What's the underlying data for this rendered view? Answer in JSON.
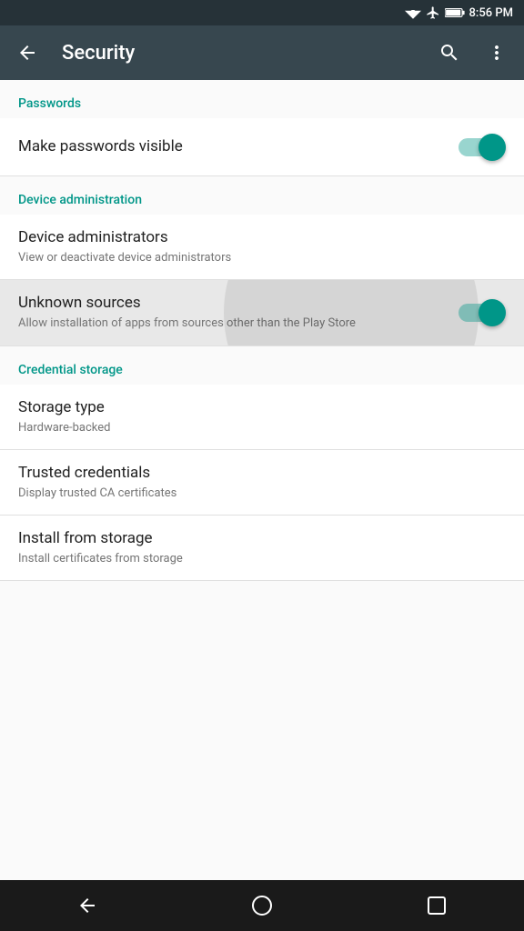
{
  "statusBar": {
    "time": "8:56 PM"
  },
  "appBar": {
    "title": "Security",
    "backLabel": "←",
    "searchLabel": "🔍",
    "moreLabel": "⋮"
  },
  "sections": [
    {
      "id": "passwords",
      "header": "Passwords",
      "items": [
        {
          "id": "make-passwords-visible",
          "title": "Make passwords visible",
          "subtitle": "",
          "hasToggle": true,
          "toggleOn": true,
          "highlighted": false
        }
      ]
    },
    {
      "id": "device-administration",
      "header": "Device administration",
      "items": [
        {
          "id": "device-administrators",
          "title": "Device administrators",
          "subtitle": "View or deactivate device administrators",
          "hasToggle": false,
          "highlighted": false
        },
        {
          "id": "unknown-sources",
          "title": "Unknown sources",
          "subtitle": "Allow installation of apps from sources other than the Play Store",
          "hasToggle": true,
          "toggleOn": true,
          "highlighted": true
        }
      ]
    },
    {
      "id": "credential-storage",
      "header": "Credential storage",
      "items": [
        {
          "id": "storage-type",
          "title": "Storage type",
          "subtitle": "Hardware-backed",
          "hasToggle": false,
          "highlighted": false
        },
        {
          "id": "trusted-credentials",
          "title": "Trusted credentials",
          "subtitle": "Display trusted CA certificates",
          "hasToggle": false,
          "highlighted": false
        },
        {
          "id": "install-from-storage",
          "title": "Install from storage",
          "subtitle": "Install certificates from storage",
          "hasToggle": false,
          "highlighted": false
        }
      ]
    }
  ],
  "navBar": {
    "backIcon": "◁",
    "homeIcon": "○",
    "recentIcon": "□"
  }
}
